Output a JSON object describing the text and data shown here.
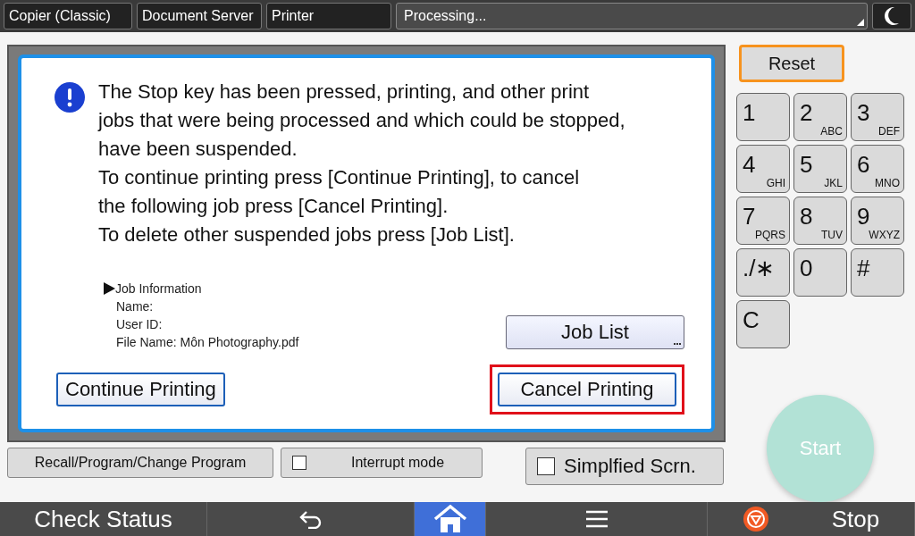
{
  "top_tabs": [
    {
      "label": "Copier (Classic)"
    },
    {
      "label": "Document Server"
    },
    {
      "label": "Printer"
    }
  ],
  "status_field": {
    "text": "Processing..."
  },
  "dialog": {
    "message_lines": [
      "The Stop key has been pressed, printing, and other print",
      "jobs that were being processed and which could be stopped,",
      "have been suspended.",
      "To continue printing press [Continue Printing], to cancel",
      "the following job press [Cancel Printing].",
      "To delete other suspended jobs press [Job List]."
    ],
    "job_info": {
      "heading": "Job Information",
      "fields": [
        "Name:",
        "User ID:",
        "File Name: Môn Photography.pdf"
      ]
    },
    "job_list_button": "Job List",
    "buttons": [
      {
        "label": "Continue Printing",
        "highlighted": false
      },
      {
        "label": "Cancel Printing",
        "highlighted": true
      }
    ]
  },
  "bottom_buttons": [
    {
      "kind": "button",
      "label": "Recall/Program/Change Program"
    },
    {
      "kind": "checkbox",
      "label": "Interrupt mode",
      "checked": false
    }
  ],
  "simplified_screen": {
    "label": "Simplfied Scrn.",
    "checked": false
  },
  "reset_button": "Reset",
  "keypad": [
    {
      "key": "1"
    },
    {
      "key": "2",
      "letters": "ABC"
    },
    {
      "key": "3",
      "letters": "DEF"
    },
    {
      "key": "4",
      "letters": "GHI"
    },
    {
      "key": "5",
      "letters": "JKL"
    },
    {
      "key": "6",
      "letters": "MNO"
    },
    {
      "key": "7",
      "letters": "PQRS"
    },
    {
      "key": "8",
      "letters": "TUV"
    },
    {
      "key": "9",
      "letters": "WXYZ"
    },
    {
      "key": "./∗"
    },
    {
      "key": "0"
    },
    {
      "key": "#"
    },
    {
      "key": "C"
    }
  ],
  "start_button": {
    "label": "Start",
    "disabled": true
  },
  "nav": [
    {
      "kind": "text",
      "label": "Check Status",
      "selected": false
    },
    {
      "kind": "back",
      "selected": false
    },
    {
      "kind": "home",
      "selected": true
    },
    {
      "kind": "menu",
      "selected": false
    },
    {
      "kind": "stop",
      "label": "Stop",
      "selected": false
    }
  ]
}
